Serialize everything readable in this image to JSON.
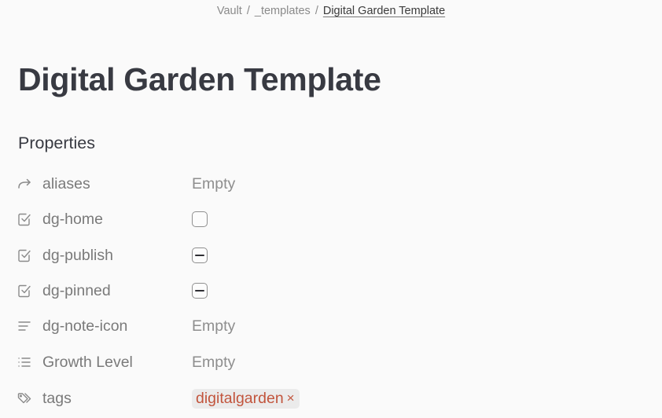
{
  "breadcrumb": {
    "items": [
      "Vault",
      "_templates"
    ],
    "separator": "/",
    "current": "Digital Garden Template"
  },
  "page": {
    "title": "Digital Garden Template",
    "properties_heading": "Properties"
  },
  "properties": [
    {
      "icon": "alias-arrow-icon",
      "key": "aliases",
      "type": "text",
      "value": "Empty"
    },
    {
      "icon": "checkbox-icon",
      "key": "dg-home",
      "type": "checkbox",
      "state": "unchecked"
    },
    {
      "icon": "checkbox-icon",
      "key": "dg-publish",
      "type": "checkbox",
      "state": "indeterminate"
    },
    {
      "icon": "checkbox-icon",
      "key": "dg-pinned",
      "type": "checkbox",
      "state": "indeterminate"
    },
    {
      "icon": "text-lines-icon",
      "key": "dg-note-icon",
      "type": "text",
      "value": "Empty"
    },
    {
      "icon": "list-icon",
      "key": "Growth Level",
      "type": "list",
      "value": "Empty"
    },
    {
      "icon": "tags-icon",
      "key": "tags",
      "type": "tags",
      "tags": [
        {
          "label": "digitalgarden",
          "remove": "×"
        }
      ]
    }
  ],
  "colors": {
    "tag_text": "#c2553d",
    "tag_bg": "#ebebeb",
    "title": "#383a42",
    "muted": "#8a8a8a"
  }
}
